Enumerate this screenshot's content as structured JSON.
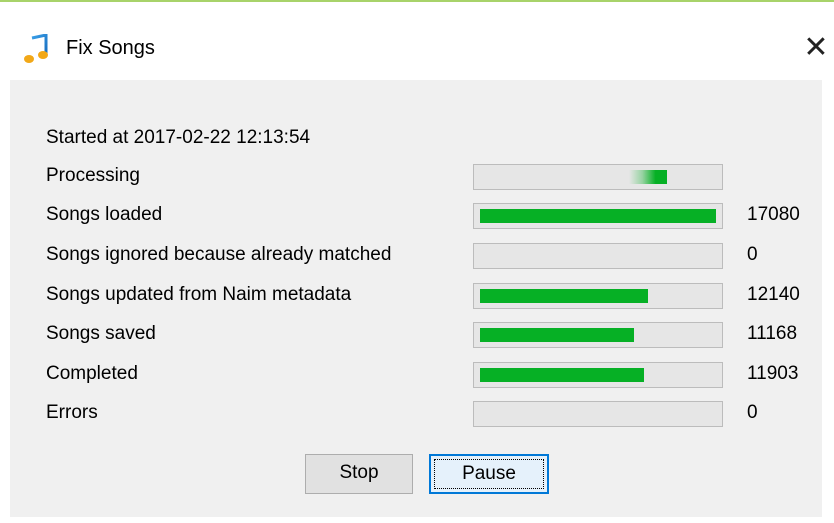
{
  "window": {
    "title": "Fix Songs",
    "icon": "music-note-icon",
    "close_glyph": "✕",
    "accent_color": "#a8d36a"
  },
  "status": {
    "started": "Started at 2017-02-22 12:13:54"
  },
  "rows": [
    {
      "label": "Processing",
      "value": "",
      "progress": null,
      "indeterminate": true
    },
    {
      "label": "Songs loaded",
      "value": "17080",
      "progress": 1.0
    },
    {
      "label": "Songs ignored because already matched",
      "value": "0",
      "progress": 0
    },
    {
      "label": "Songs updated from Naim metadata",
      "value": "12140",
      "progress": 0.7108
    },
    {
      "label": "Songs saved",
      "value": "11168",
      "progress": 0.6539
    },
    {
      "label": "Completed",
      "value": "11903",
      "progress": 0.6969
    },
    {
      "label": "Errors",
      "value": "0",
      "progress": 0
    }
  ],
  "buttons": {
    "stop_label": "Stop",
    "pause_label": "Pause"
  },
  "colors": {
    "progress_fill": "#06b025",
    "panel_background": "#f0f0f0",
    "focus_border": "#0078d7"
  }
}
